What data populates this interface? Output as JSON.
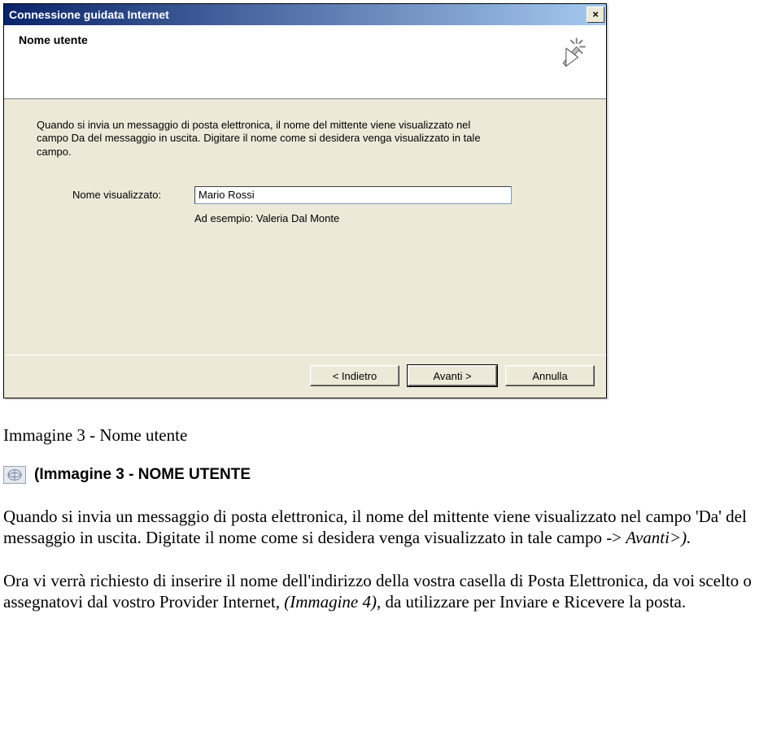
{
  "dialog": {
    "title": "Connessione guidata Internet",
    "close_glyph": "×",
    "header_title": "Nome utente",
    "body_desc": "Quando si invia un messaggio di posta elettronica, il nome del mittente viene visualizzato nel campo Da del messaggio in uscita. Digitare il nome come si desidera venga visualizzato in tale campo.",
    "field_label": "Nome visualizzato:",
    "field_value": "Mario Rossi",
    "example_text": "Ad esempio: Valeria Dal Monte",
    "buttons": {
      "back": "< Indietro",
      "next": "Avanti >",
      "cancel": "Annulla"
    }
  },
  "doc": {
    "caption": "Immagine 3 - Nome utente",
    "subhead": "(Immagine 3 - NOME UTENTE",
    "para1": "Quando si invia un messaggio di posta elettronica, il nome del mittente viene visualizzato nel campo 'Da' del messaggio in uscita. Digitate il nome come si desidera venga visualizzato in tale campo -> ",
    "para1_tail": "Avanti>).",
    "para2_a": "Ora vi verrà richiesto di inserire il nome dell'indirizzo della vostra casella di Posta Elettronica, da voi scelto o assegnatovi dal vostro Provider Internet, ",
    "para2_italic": "(Immagine 4)",
    "para2_b": ", da utilizzare per Inviare e Ricevere la posta."
  }
}
